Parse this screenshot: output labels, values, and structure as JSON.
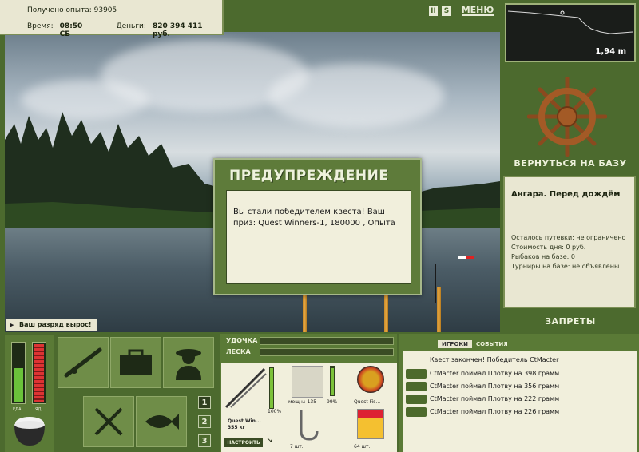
{
  "hud": {
    "experience_label": "Получено опыта:",
    "experience_value": "93905",
    "time_label": "Время:",
    "time_value": "08:50 СБ",
    "money_label": "Деньги:",
    "money_value": "820 394 411 руб."
  },
  "topbar": {
    "pause": "II",
    "sound": "S",
    "menu": "МЕНЮ"
  },
  "depth": {
    "value": "1,94 m"
  },
  "right_panel": {
    "return_label": "ВЕРНУТЬСЯ НА БАЗУ",
    "location_title": "Ангара. Перед дождём",
    "lines": [
      "Осталось путевки: не ограничено",
      "Стоимость дня: 0 руб.",
      "Рыбаков на базе: 0",
      "Турниры на базе: не объявлены"
    ],
    "bans_label": "ЗАПРЕТЫ"
  },
  "dialog": {
    "title": "ПРЕДУПРЕЖДЕНИЕ",
    "message": "Вы стали победителем квеста! Ваш приз: Quest Winners-1, 180000 , Опыта"
  },
  "rank_banner": "Ваш разряд вырос!",
  "meters": {
    "food_label": "ЕДА",
    "poison_label": "ЯД",
    "food_level": 0.55,
    "poison_level": 0.95
  },
  "tabs": [
    "1",
    "2",
    "3"
  ],
  "tackle": {
    "rod_label": "УДОЧКА",
    "line_label": "ЛЕСКА",
    "rod_name": "Quest Win...",
    "rod_weight": "355 кг",
    "rod_percent": "100%",
    "reel_stat": "мощн.: 135",
    "reel_percent": "99%",
    "line_name": "Quest Fis...",
    "hook_count": "7 шт.",
    "bait_count": "64 шт.",
    "setup_button": "НАСТРОИТЬ"
  },
  "chat": {
    "tab_players": "ИГРОКИ",
    "tab_events": "СОБЫТИЯ",
    "messages": [
      "Квест закончен! Победитель CtMacter",
      "CtMacter поймал Плотву на 398 грамм",
      "CtMacter поймал Плотву на 356 грамм",
      "CtMacter поймал Плотву на 222 грамм",
      "CtMacter поймал Плотву на 226 грамм"
    ]
  }
}
